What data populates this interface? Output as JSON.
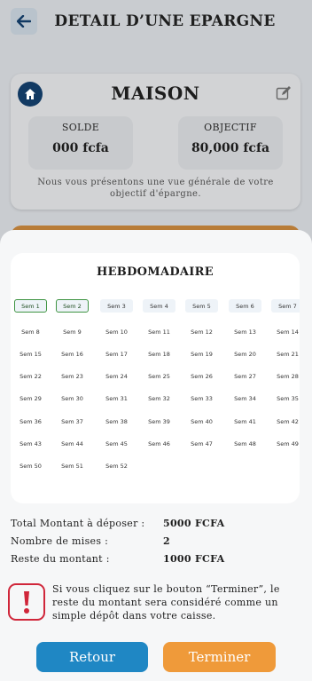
{
  "header": {
    "title": "DETAIL D’UNE EPARGNE"
  },
  "summary": {
    "name": "MAISON",
    "solde_label": "SOLDE",
    "solde_value": "000 fcfa",
    "objectif_label": "OBJECTIF",
    "objectif_value": "80,000 fcfa",
    "description": "Nous vous présentons une vue générale de votre objectif d'épargne."
  },
  "weeks": {
    "title": "HEBDOMADAIRE",
    "rows": [
      [
        {
          "label": "Sem 1",
          "done": true
        },
        {
          "label": "Sem 2",
          "done": true
        },
        {
          "label": "Sem 3",
          "done": false
        },
        {
          "label": "Sem 4",
          "done": false
        },
        {
          "label": "Sem 5",
          "done": false
        },
        {
          "label": "Sem 6",
          "done": false
        },
        {
          "label": "Sem 7",
          "done": false
        }
      ],
      [
        {
          "label": "Sem 8"
        },
        {
          "label": "Sem 9"
        },
        {
          "label": "Sem 10"
        },
        {
          "label": "Sem 11"
        },
        {
          "label": "Sem 12"
        },
        {
          "label": "Sem 13"
        },
        {
          "label": "Sem 14"
        }
      ],
      [
        {
          "label": "Sem 15"
        },
        {
          "label": "Sem 16"
        },
        {
          "label": "Sem 17"
        },
        {
          "label": "Sem 18"
        },
        {
          "label": "Sem 19"
        },
        {
          "label": "Sem 20"
        },
        {
          "label": "Sem 21"
        }
      ],
      [
        {
          "label": "Sem 22"
        },
        {
          "label": "Sem 23"
        },
        {
          "label": "Sem 24"
        },
        {
          "label": "Sem 25"
        },
        {
          "label": "Sem 26"
        },
        {
          "label": "Sem 27"
        },
        {
          "label": "Sem 28"
        }
      ],
      [
        {
          "label": "Sem 29"
        },
        {
          "label": "Sem 30"
        },
        {
          "label": "Sem 31"
        },
        {
          "label": "Sem 32"
        },
        {
          "label": "Sem 33"
        },
        {
          "label": "Sem 34"
        },
        {
          "label": "Sem 35"
        }
      ],
      [
        {
          "label": "Sem 36"
        },
        {
          "label": "Sem 37"
        },
        {
          "label": "Sem 38"
        },
        {
          "label": "Sem 39"
        },
        {
          "label": "Sem 40"
        },
        {
          "label": "Sem 41"
        },
        {
          "label": "Sem 42"
        }
      ],
      [
        {
          "label": "Sem 43"
        },
        {
          "label": "Sem 44"
        },
        {
          "label": "Sem 45"
        },
        {
          "label": "Sem 46"
        },
        {
          "label": "Sem 47"
        },
        {
          "label": "Sem 48"
        },
        {
          "label": "Sem 49"
        }
      ],
      [
        {
          "label": "Sem 50"
        },
        {
          "label": "Sem 51"
        },
        {
          "label": "Sem 52"
        }
      ]
    ]
  },
  "totals": {
    "total_label": "Total Montant à déposer :",
    "total_value": "5000 FCFA",
    "mises_label": "Nombre de mises :",
    "mises_value": "2",
    "reste_label": "Reste du montant :",
    "reste_value": "1000 FCFA"
  },
  "warning": {
    "icon": "exclamation-icon",
    "text": "Si vous cliquez sur le bouton “Terminer”, le reste du montant sera considéré comme un simple dépôt dans votre caisse."
  },
  "actions": {
    "back_label": "Retour",
    "finish_label": "Terminer"
  },
  "colors": {
    "primary": "#1f87c4",
    "accent": "#ef9a3a",
    "done": "#4caf50",
    "warning": "#d0263a",
    "navy": "#123a63"
  }
}
